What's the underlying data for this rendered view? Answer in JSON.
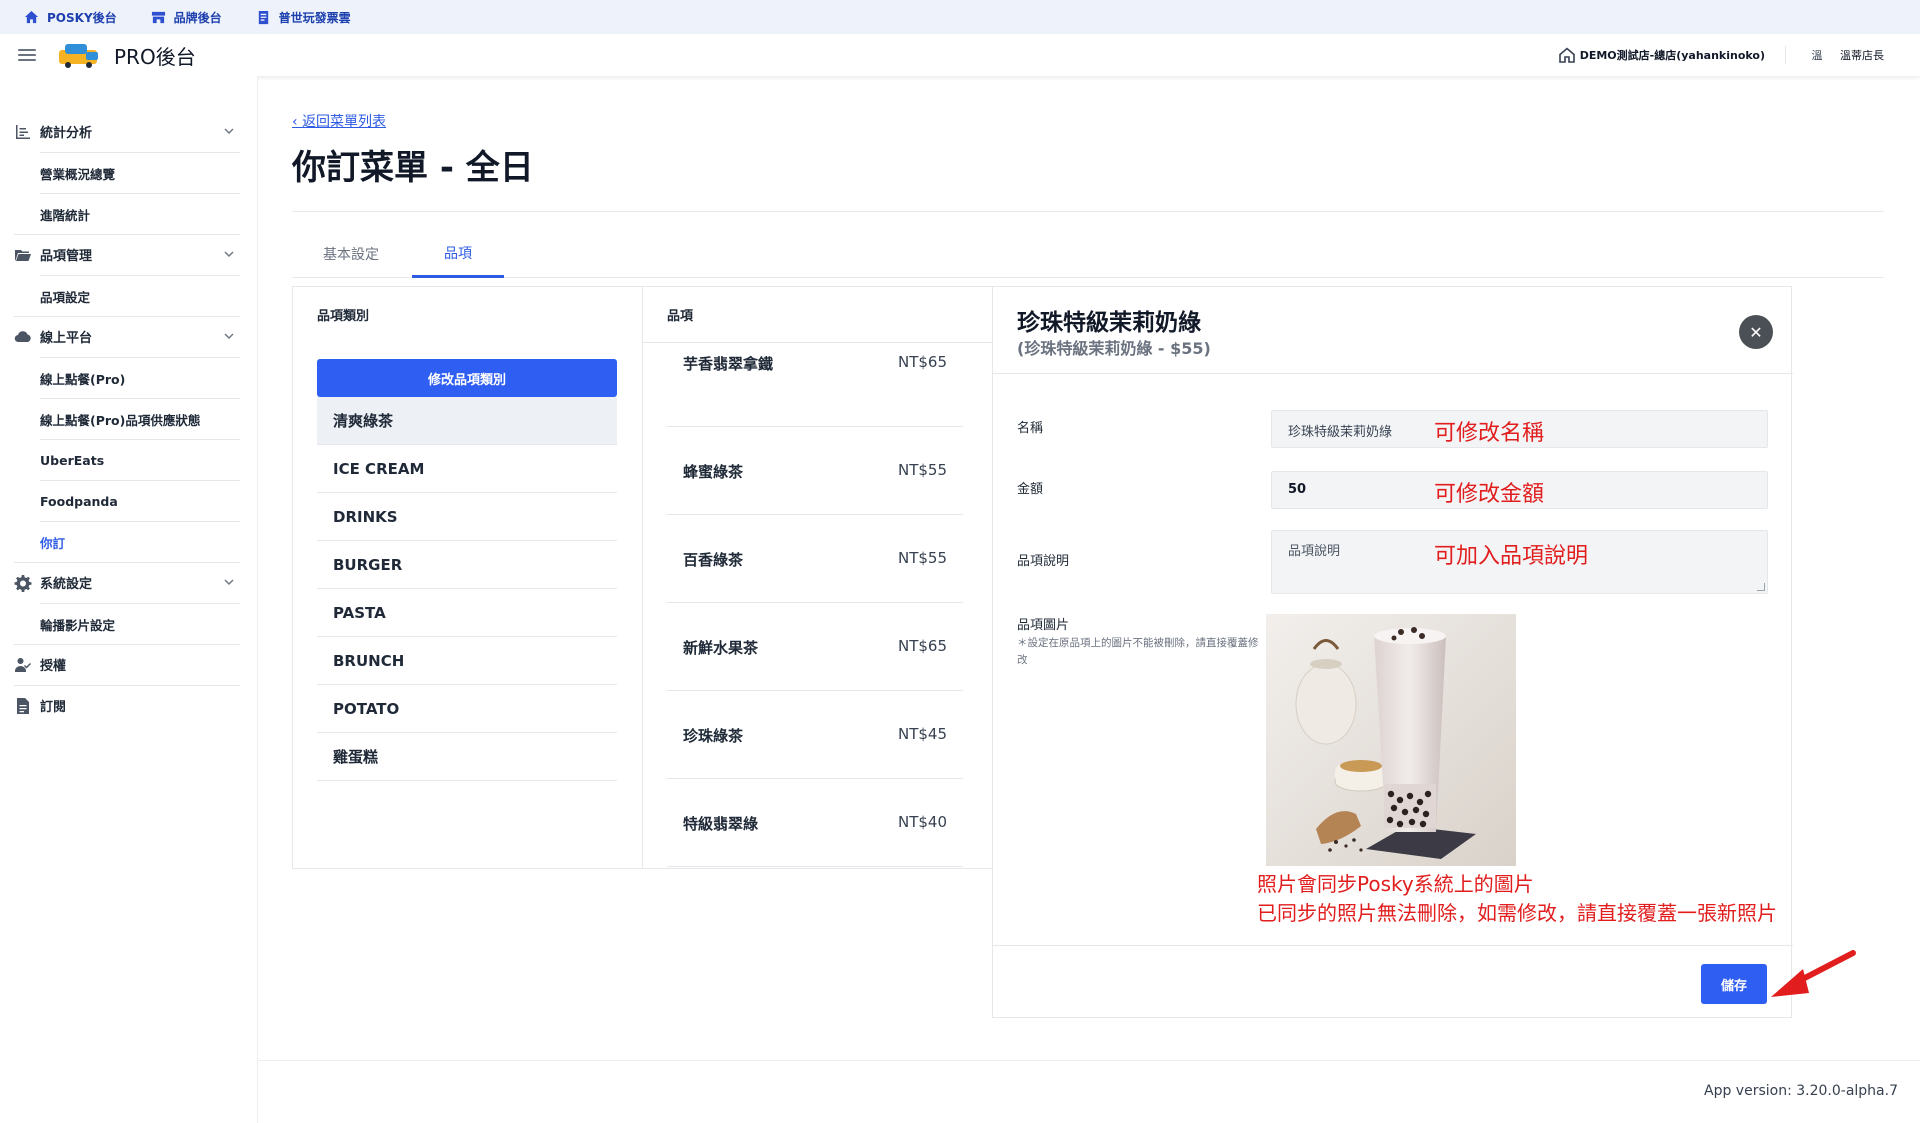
{
  "topbar": {
    "links": [
      {
        "label": "POSKY後台",
        "icon": "home-icon"
      },
      {
        "label": "品牌後台",
        "icon": "store-icon"
      },
      {
        "label": "普世玩發票雲",
        "icon": "invoice-icon"
      }
    ]
  },
  "header": {
    "title": "PRO後台",
    "store_name": "DEMO測試店-總店(yahankinoko)",
    "user_avatar": "溫",
    "user_name": "溫蒂店長"
  },
  "sidebar": {
    "groups": [
      {
        "label": "統計分析",
        "icon": "bar-chart-icon"
      },
      {
        "label": "品項管理",
        "icon": "folder-icon"
      },
      {
        "label": "線上平台",
        "icon": "cloud-icon"
      },
      {
        "label": "系統設定",
        "icon": "gear-icon"
      },
      {
        "label": "授權",
        "icon": "user-check-icon"
      },
      {
        "label": "訂閱",
        "icon": "document-icon"
      }
    ],
    "items": {
      "stats_overview": "營業概況總覽",
      "stats_advanced": "進階統計",
      "items_settings": "品項設定",
      "online_order": "線上點餐(Pro)",
      "online_supply": "線上點餐(Pro)品項供應狀態",
      "ubereats": "UberEats",
      "foodpanda": "Foodpanda",
      "nido": "你訂",
      "carousel": "輪播影片設定"
    }
  },
  "main": {
    "back_link": "返回菜單列表",
    "title": "你訂菜單 - 全日",
    "tabs": [
      "基本設定",
      "品項"
    ],
    "active_tab": "品項"
  },
  "categories": {
    "header": "品項類別",
    "edit_button": "修改品項類別",
    "list": [
      "清爽綠茶",
      "ICE CREAM",
      "DRINKS",
      "BURGER",
      "PASTA",
      "BRUNCH",
      "POTATO",
      "雞蛋糕"
    ],
    "selected": "清爽綠茶"
  },
  "products": {
    "header": "品項",
    "list": [
      {
        "name": "芋香翡翠拿鐵",
        "price": "NT$65"
      },
      {
        "name": "蜂蜜綠茶",
        "price": "NT$55"
      },
      {
        "name": "百香綠茶",
        "price": "NT$55"
      },
      {
        "name": "新鮮水果茶",
        "price": "NT$65"
      },
      {
        "name": "珍珠綠茶",
        "price": "NT$45"
      },
      {
        "name": "特級翡翠綠",
        "price": "NT$40"
      }
    ]
  },
  "detail": {
    "title": "珍珠特級茉莉奶綠",
    "subtitle": "(珍珠特級茉莉奶綠 - $55)",
    "name_label": "名稱",
    "name_value": "珍珠特級茉莉奶綠",
    "price_label": "金額",
    "price_value": "50",
    "desc_label": "品項說明",
    "desc_placeholder": "品項說明",
    "image_label": "品項圖片",
    "image_note": "＊設定在原品項上的圖片不能被刪除，請直接覆蓋修改",
    "save_label": "儲存"
  },
  "annotations": {
    "name": "可修改名稱",
    "price": "可修改金額",
    "desc": "可加入品項說明",
    "photo_line1": "照片會同步Posky系統上的圖片",
    "photo_line2": "已同步的照片無法刪除，如需修改，請直接覆蓋一張新照片"
  },
  "footer": {
    "app_version": "App version: 3.20.0-alpha.7"
  },
  "colors": {
    "accent": "#2f5ef2",
    "annotation": "#e11d1d",
    "topbar_bg": "#eef3fb"
  }
}
